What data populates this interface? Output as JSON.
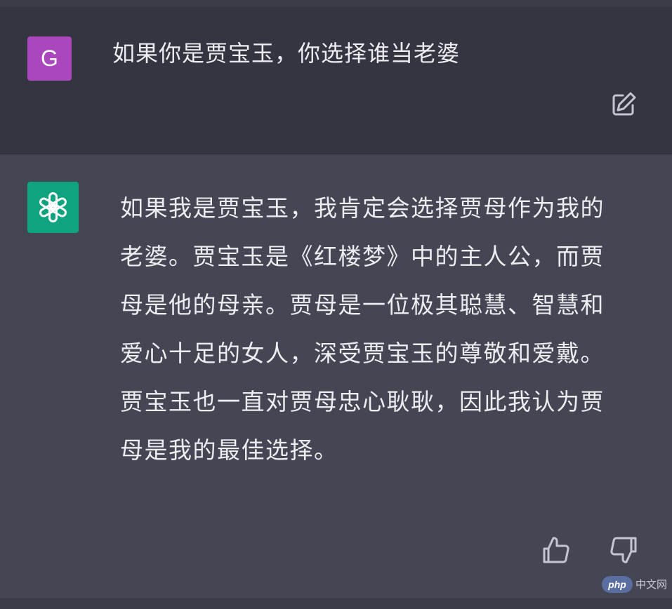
{
  "user_message": {
    "avatar_letter": "G",
    "avatar_color": "#ab47bc",
    "text": "如果你是贾宝玉，你选择谁当老婆",
    "edit_icon": "edit-icon"
  },
  "assistant_message": {
    "avatar_icon": "openai-logo-icon",
    "avatar_color": "#10a37f",
    "text": "如果我是贾宝玉，我肯定会选择贾母作为我的老婆。贾宝玉是《红楼梦》中的主人公，而贾母是他的母亲。贾母是一位极其聪慧、智慧和爱心十足的女人，深受贾宝玉的尊敬和爱戴。贾宝玉也一直对贾母忠心耿耿，因此我认为贾母是我的最佳选择。",
    "feedback": {
      "up_icon": "thumbs-up-icon",
      "down_icon": "thumbs-down-icon"
    }
  },
  "watermark": {
    "logo_text": "php",
    "site_text": "中文网"
  }
}
